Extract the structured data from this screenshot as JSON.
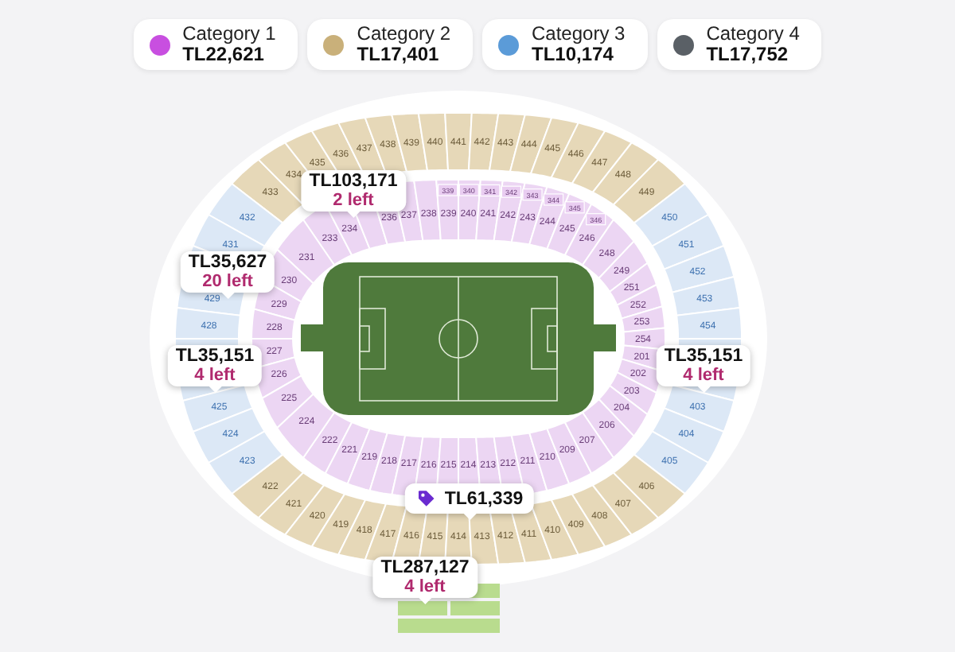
{
  "legend": [
    {
      "name": "Category 1",
      "price": "TL22,621",
      "color": "#c84fe0"
    },
    {
      "name": "Category 2",
      "price": "TL17,401",
      "color": "#c9b07a"
    },
    {
      "name": "Category 3",
      "price": "TL10,174",
      "color": "#5b9bd8"
    },
    {
      "name": "Category 4",
      "price": "TL17,752",
      "color": "#5a6066"
    }
  ],
  "upper_tier": {
    "top": {
      "color": "#e6d8b8",
      "sections": [
        "433",
        "434",
        "435",
        "436",
        "437",
        "438",
        "439",
        "440",
        "441",
        "442",
        "443",
        "444",
        "445",
        "446",
        "447",
        "448",
        "449"
      ]
    },
    "right": {
      "color": "#dce8f6",
      "sections": [
        "450",
        "451",
        "452",
        "453",
        "454",
        "403",
        "404",
        "405"
      ]
    },
    "bottom": {
      "color": "#e6d8b8",
      "sections": [
        "422",
        "421",
        "420",
        "419",
        "418",
        "417",
        "416",
        "415",
        "414",
        "413",
        "412",
        "411",
        "410",
        "409",
        "408",
        "407",
        "406"
      ]
    },
    "left": {
      "color": "#dce8f6",
      "sections": [
        "432",
        "431",
        "429",
        "428",
        "425",
        "424",
        "423"
      ]
    }
  },
  "lower_tier": {
    "top": {
      "color": "#ecd6f3",
      "sections": [
        "233",
        "234",
        "236",
        "237",
        "238",
        "239",
        "240",
        "241",
        "242",
        "243",
        "244",
        "245",
        "246"
      ]
    },
    "right": {
      "color": "#ecd6f3",
      "sections": [
        "248",
        "249",
        "251",
        "252",
        "253",
        "254",
        "201",
        "202",
        "203",
        "204",
        "206"
      ]
    },
    "bottom": {
      "color": "#ecd6f3",
      "sections": [
        "222",
        "221",
        "219",
        "218",
        "217",
        "216",
        "215",
        "214",
        "213",
        "212",
        "211",
        "210",
        "209",
        "207"
      ]
    },
    "left": {
      "color": "#ecd6f3",
      "sections": [
        "231",
        "230",
        "229",
        "228",
        "227",
        "226",
        "225",
        "224"
      ]
    }
  },
  "suites": [
    "339",
    "340",
    "341",
    "342",
    "343",
    "344",
    "345",
    "346"
  ],
  "callouts": [
    {
      "kind": "stock",
      "price": "TL103,171",
      "left": "2 left"
    },
    {
      "kind": "stock",
      "price": "TL35,627",
      "left": "20 left"
    },
    {
      "kind": "stock",
      "price": "TL35,151",
      "left": "4 left"
    },
    {
      "kind": "stock",
      "price": "TL35,151",
      "left": "4 left"
    },
    {
      "kind": "deal",
      "price": "TL61,339"
    },
    {
      "kind": "stock",
      "price": "TL287,127",
      "left": "4 left"
    }
  ]
}
